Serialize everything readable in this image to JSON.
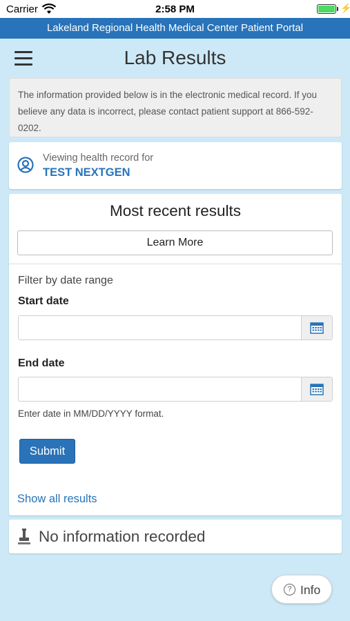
{
  "status_bar": {
    "carrier": "Carrier",
    "time": "2:58 PM",
    "battery_level": 1.0,
    "battery_color": "#4cd964"
  },
  "portal_banner": {
    "title": "Lakeland Regional Health Medical Center Patient Portal",
    "background": "#2873b9"
  },
  "header": {
    "menu_icon": "hamburger-menu-icon",
    "title": "Lab Results"
  },
  "notice": {
    "text": "The information provided below is in the electronic medical record. If you believe any data is incorrect, please contact patient support at 866-592-0202."
  },
  "record": {
    "icon": "user-circle-icon",
    "label": "Viewing health record for",
    "patient_name": "TEST NEXTGEN"
  },
  "results": {
    "title": "Most recent results",
    "learn_more_label": "Learn More",
    "filter_label": "Filter by date range",
    "start_date": {
      "label": "Start date",
      "value": "",
      "icon": "calendar-icon"
    },
    "end_date": {
      "label": "End date",
      "value": "",
      "icon": "calendar-icon"
    },
    "date_hint": "Enter date in MM/DD/YYYY format.",
    "submit_label": "Submit",
    "show_all_label": "Show all results"
  },
  "no_info": {
    "icon": "stamp-icon",
    "text": "No information recorded"
  },
  "info_button": {
    "icon": "question-circle-icon",
    "label": "Info"
  },
  "colors": {
    "page_background": "#cde9f7",
    "accent": "#2873b9",
    "submit": "#2a73b8"
  }
}
